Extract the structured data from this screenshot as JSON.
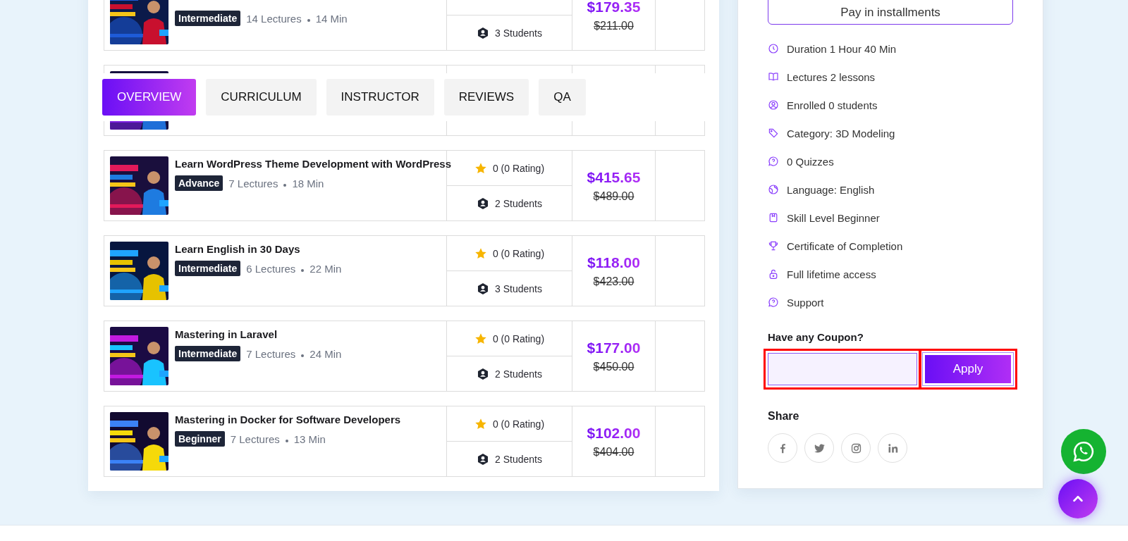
{
  "courses": [
    {
      "kind": "course",
      "level": "Intermediate",
      "lectures": "14 Lectures",
      "minutes": "14 Min",
      "students": "3 Students",
      "price": "$179.35",
      "old_price": "$211.00"
    },
    {
      "kind": "covered"
    },
    {
      "kind": "course",
      "title": "Learn WordPress Theme Development with WordPress",
      "level": "Advance",
      "lectures": "7 Lectures",
      "minutes": "18 Min",
      "rating": "0 (0 Rating)",
      "students": "2 Students",
      "price": "$415.65",
      "old_price": "$489.00"
    },
    {
      "kind": "course",
      "title": "Learn English in 30 Days",
      "level": "Intermediate",
      "lectures": "6 Lectures",
      "minutes": "22 Min",
      "rating": "0 (0 Rating)",
      "students": "3 Students",
      "price": "$118.00",
      "old_price": "$423.00"
    },
    {
      "kind": "course",
      "title": "Mastering in Laravel",
      "level": "Intermediate",
      "lectures": "7 Lectures",
      "minutes": "24 Min",
      "rating": "0 (0 Rating)",
      "students": "2 Students",
      "price": "$177.00",
      "old_price": "$450.00"
    },
    {
      "kind": "course",
      "title": "Mastering in Docker for Software Developers",
      "level": "Beginner",
      "lectures": "7 Lectures",
      "minutes": "13 Min",
      "rating": "0 (0 Rating)",
      "students": "2 Students",
      "price": "$102.00",
      "old_price": "$404.00"
    }
  ],
  "tabs": [
    {
      "label": "OVERVIEW",
      "selected": true
    },
    {
      "label": "CURRICULUM",
      "selected": false
    },
    {
      "label": "INSTRUCTOR",
      "selected": false
    },
    {
      "label": "REVIEWS",
      "selected": false
    },
    {
      "label": "QA",
      "selected": false
    }
  ],
  "sidebar": {
    "installments_button": "Pay in installments",
    "features": [
      "Duration 1 Hour 40 Min",
      "Lectures 2 lessons",
      "Enrolled 0 students",
      "Category: 3D Modeling",
      "0 Quizzes",
      "Language: English",
      "Skill Level Beginner",
      "Certificate of Completion",
      "Full lifetime access",
      "Support"
    ],
    "coupon_label": "Have any Coupon?",
    "apply_button": "Apply",
    "share_label": "Share"
  }
}
